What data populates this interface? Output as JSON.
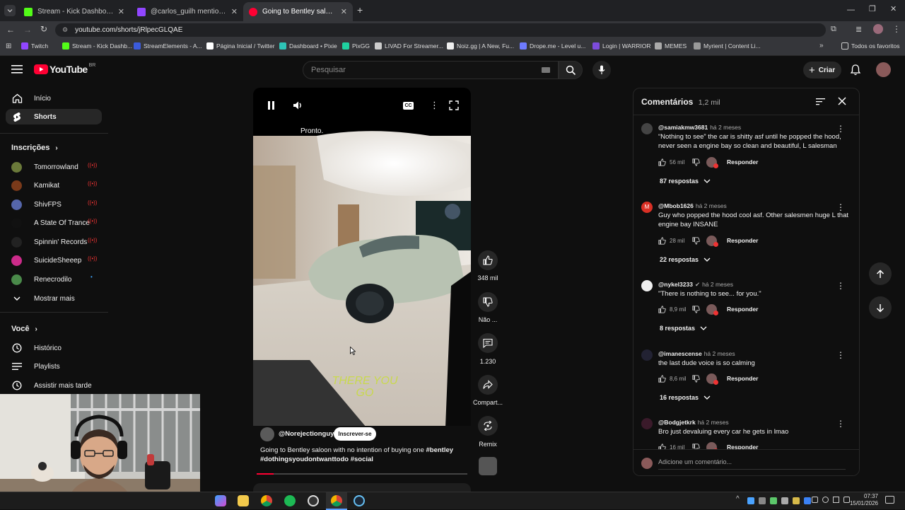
{
  "browser": {
    "tabs": [
      {
        "title": "Stream - Kick Dashboard",
        "color": "#53fc18"
      },
      {
        "title": "@carlos_guilh mentioned y",
        "color": "#9146ff"
      },
      {
        "title": "Going to Bentley saloon wi",
        "color": "#ff0033"
      }
    ],
    "url": "youtube.com/shorts/jRlpecGLQAE",
    "bookmarks": [
      {
        "label": "Twitch",
        "color": "#9146ff"
      },
      {
        "label": "Stream - Kick Dashb...",
        "color": "#53fc18"
      },
      {
        "label": "StreamElements - A...",
        "color": "#3b5bdb"
      },
      {
        "label": "Página Inicial / Twitter",
        "color": "#ffffff"
      },
      {
        "label": "Dashboard • Pixie",
        "color": "#2ec4b6"
      },
      {
        "label": "PixGG",
        "color": "#1fd1a0"
      },
      {
        "label": "LIVAD For Streamer...",
        "color": "#cccccc"
      },
      {
        "label": "Noiz.gg | A New, Fu...",
        "color": "#eeeeee"
      },
      {
        "label": "Drope.me - Level u...",
        "color": "#6e7bff"
      },
      {
        "label": "Login | WARRIOR",
        "color": "#7d4cdb"
      },
      {
        "label": "MEMES",
        "color": "#aaaaaa"
      },
      {
        "label": "Myrient | Content Li...",
        "color": "#999999"
      }
    ],
    "all_bookmarks": "Todos os favoritos"
  },
  "youtube": {
    "logo": "YouTube",
    "region": "BR",
    "search_placeholder": "Pesquisar",
    "create_label": "Criar"
  },
  "sidebar": {
    "home": "Início",
    "shorts": "Shorts",
    "subscriptions_title": "Inscrições",
    "subscriptions": [
      {
        "name": "Tomorrowland",
        "color": "#6b7a3a",
        "live": true
      },
      {
        "name": "Kamikat",
        "color": "#7a3a1a",
        "live": true
      },
      {
        "name": "ShivFPS",
        "color": "#5566aa",
        "live": true
      },
      {
        "name": "A State Of Trance",
        "color": "#111111",
        "live": true
      },
      {
        "name": "Spinnin' Records",
        "color": "#222222",
        "live": true
      },
      {
        "name": "SuicideSheeep",
        "color": "#cc2b8a",
        "live": true
      },
      {
        "name": "Renecrodilo",
        "color": "#4a8a4a",
        "live": false
      }
    ],
    "show_more": "Mostrar mais",
    "you_title": "Você",
    "you_items": [
      "Histórico",
      "Playlists",
      "Assistir mais tarde"
    ]
  },
  "player": {
    "status": "Pronto.",
    "caption_overlay": "THERE YOU\nGO",
    "channel": "@Norejectionguy",
    "subscribe": "Inscrever-se",
    "title_plain": "Going to Bentley saloon with no intention of buying one ",
    "title_tags": "#bentley #dothingsyoudontwanttodo #social",
    "likes": "348 mil",
    "dislike": "Não ...",
    "comments_count": "1.230",
    "share": "Compart...",
    "remix": "Remix",
    "progress": 0.08
  },
  "comments": {
    "title": "Comentários",
    "count": "1,2 mil",
    "add_placeholder": "Adicione um comentário...",
    "reply_label": "Responder",
    "items": [
      {
        "handle": "@samiakmw3681",
        "time": "há 2 meses",
        "text": "“Nothing to see” the car is shitty asf until he popped the hood, never seen a engine bay so clean and beautiful, L salesman",
        "likes": "56 mil",
        "replies": "87 respostas",
        "avatar": "#444444"
      },
      {
        "handle": "@Mbob1626",
        "time": "há 2 meses",
        "text": "Guy who popped the hood cool asf. Other salesmen huge L that engine bay INSANE",
        "likes": "28 mil",
        "replies": "22 respostas",
        "avatar": "#d93025",
        "initial": "M"
      },
      {
        "handle": "@nykel3233",
        "time": "há 2 meses",
        "text": "\"There is nothing to see... for you.\"",
        "likes": "8,9 mil",
        "replies": "8 respostas",
        "avatar": "#eeeeee",
        "verified": true
      },
      {
        "handle": "@imanescense",
        "time": "há 2 meses",
        "text": "the last dude voice is so calming",
        "likes": "8,6 mil",
        "replies": "16 respostas",
        "avatar": "#222233"
      },
      {
        "handle": "@Bodgjetkrk",
        "time": "há 2 meses",
        "text": "Bro just devaluing every car he gets in lmao",
        "likes": "16 mil",
        "replies": "",
        "avatar": "#3a1a2a"
      }
    ]
  },
  "system": {
    "time": "07:37",
    "date": "15/01/2026"
  }
}
